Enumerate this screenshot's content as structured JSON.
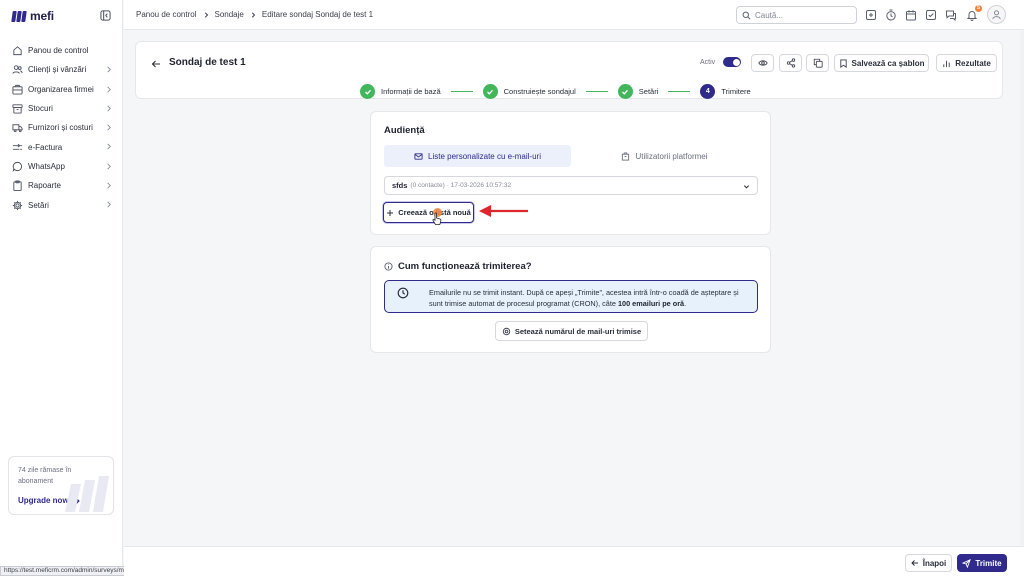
{
  "app": {
    "name": "mefi"
  },
  "sidebar": {
    "items": [
      {
        "label": "Panou de control",
        "icon": "home-icon",
        "has_chevron": false
      },
      {
        "label": "Clienți și vânzări",
        "icon": "users-icon",
        "has_chevron": true
      },
      {
        "label": "Organizarea firmei",
        "icon": "org-chart-icon",
        "has_chevron": true
      },
      {
        "label": "Stocuri",
        "icon": "box-icon",
        "has_chevron": true
      },
      {
        "label": "Furnizori și costuri",
        "icon": "truck-icon",
        "has_chevron": true
      },
      {
        "label": "e-Factura",
        "icon": "efactura-icon",
        "has_chevron": true
      },
      {
        "label": "WhatsApp",
        "icon": "whatsapp-icon",
        "has_chevron": true
      },
      {
        "label": "Rapoarte",
        "icon": "clipboard-icon",
        "has_chevron": true
      },
      {
        "label": "Setări",
        "icon": "gear-icon",
        "has_chevron": true
      }
    ],
    "upgrade": {
      "days_text": "74 zile rămase în abonament",
      "link_label": "Upgrade now"
    },
    "status_url": "https://test.meficrm.com/admin/surveys/mail_list"
  },
  "topbar": {
    "breadcrumbs": [
      "Panou de control",
      "Sondaje",
      "Editare sondaj Sondaj de test 1"
    ],
    "search_placeholder": "Caută...",
    "notification_count": "5"
  },
  "header": {
    "title": "Sondaj de test 1",
    "active_label": "Activ",
    "active": true,
    "save_template_label": "Salvează ca șablon",
    "results_label": "Rezultate"
  },
  "steps": [
    {
      "label": "Informații de bază",
      "status": "done"
    },
    {
      "label": "Construiește sondajul",
      "status": "done"
    },
    {
      "label": "Setări",
      "status": "done"
    },
    {
      "label": "Trimitere",
      "status": "current",
      "number": "4"
    }
  ],
  "audience": {
    "title": "Audiență",
    "tabs": [
      {
        "label": "Liste personalizate cu e-mail-uri",
        "active": true
      },
      {
        "label": "Utilizatorii platformei",
        "active": false
      }
    ],
    "selected_list": {
      "name": "sfds",
      "contacts": "(0 contacte)",
      "date": "· 17-03-2026 10:57:32"
    },
    "create_button_label": "Creează o listă nouă"
  },
  "how_it_works": {
    "title": "Cum funcționează trimiterea?",
    "info_text_part1": "Emailurile nu se trimit instant. După ce apeși „Trimite”, acestea intră într-o coadă de așteptare și sunt trimise automat de procesul programat (CRON), câte ",
    "info_text_bold": "100 emailuri pe oră",
    "info_text_part2": ".",
    "button_label": "Setează numărul de mail-uri trimise"
  },
  "footer": {
    "back_label": "Înapoi",
    "send_label": "Trimite"
  },
  "colors": {
    "accent": "#2f2a8c",
    "success": "#43b65c",
    "info_bg": "#e6f1fb",
    "annotation_arrow": "#e0262d"
  }
}
